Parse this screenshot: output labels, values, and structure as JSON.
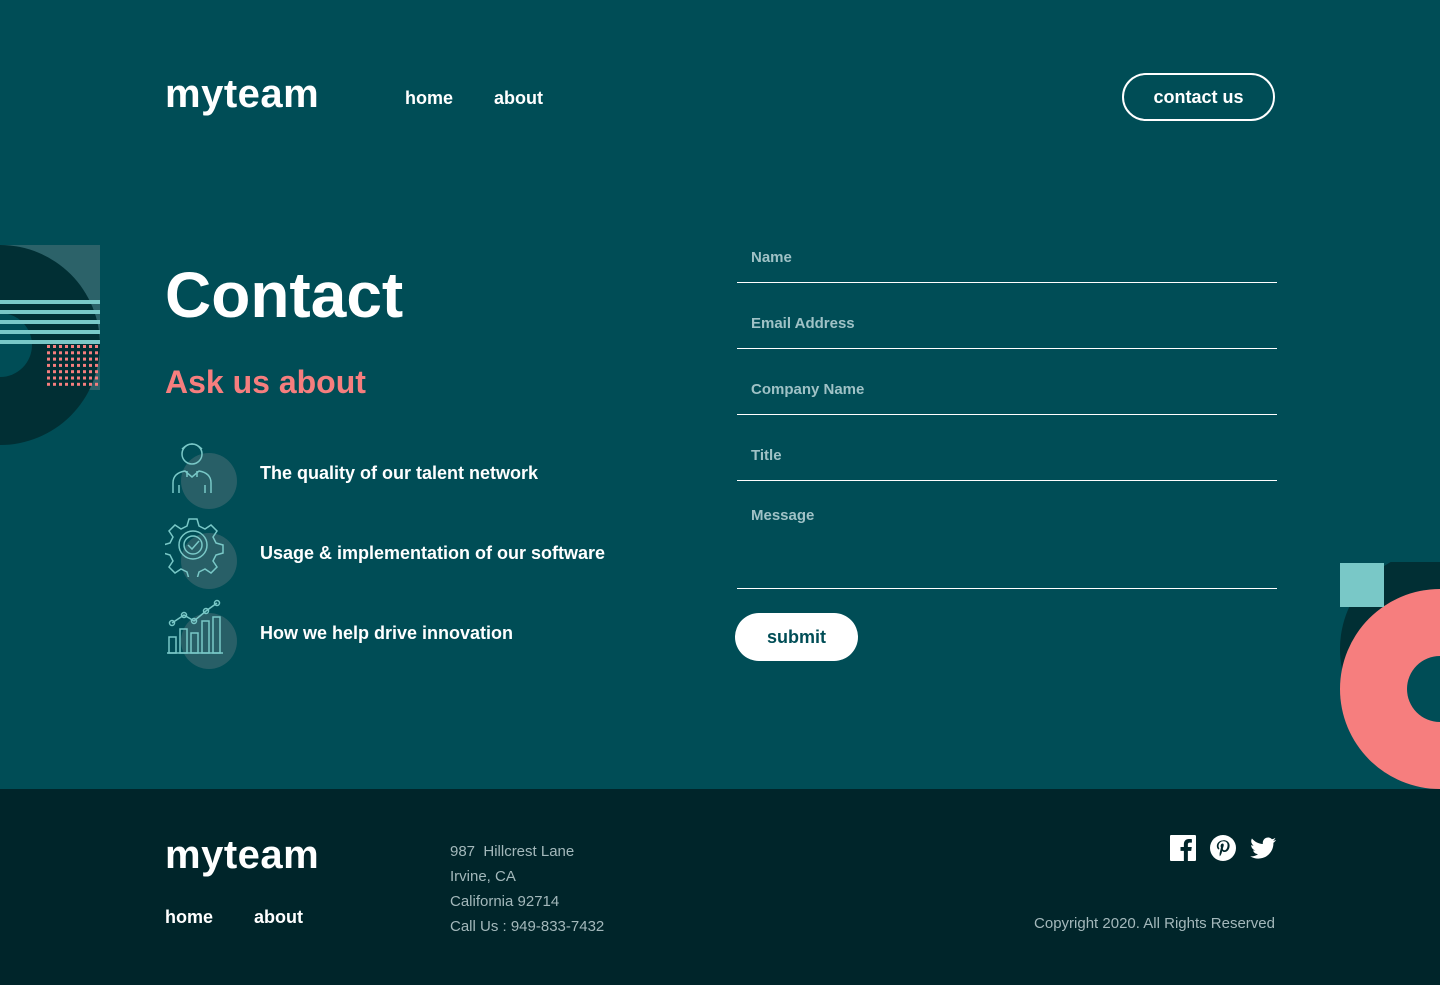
{
  "header": {
    "logo": "myteam",
    "nav": [
      {
        "label": "home"
      },
      {
        "label": "about"
      }
    ],
    "contact_button": "contact us"
  },
  "hero": {
    "title": "Contact",
    "subtitle": "Ask us about",
    "topics": [
      {
        "icon": "person-icon",
        "label": "The quality of our talent network"
      },
      {
        "icon": "gear-check-icon",
        "label": "Usage & implementation of our software"
      },
      {
        "icon": "growth-chart-icon",
        "label": "How we help drive innovation"
      }
    ]
  },
  "form": {
    "name_placeholder": "Name",
    "email_placeholder": "Email Address",
    "company_placeholder": "Company Name",
    "title_placeholder": "Title",
    "message_placeholder": "Message",
    "submit_label": "submit"
  },
  "footer": {
    "logo": "myteam",
    "nav": [
      {
        "label": "home"
      },
      {
        "label": "about"
      }
    ],
    "address": [
      "987  Hillcrest Lane",
      "Irvine, CA",
      "California 92714",
      "Call Us : 949-833-7432"
    ],
    "social": [
      "facebook-icon",
      "pinterest-icon",
      "twitter-icon"
    ],
    "copyright": "Copyright 2020. All Rights Reserved"
  },
  "colors": {
    "background": "#004D56",
    "footer": "#00252A",
    "accent_coral": "#F67E7E",
    "accent_teal": "#79C8C7",
    "dark_teal": "#012F34"
  }
}
